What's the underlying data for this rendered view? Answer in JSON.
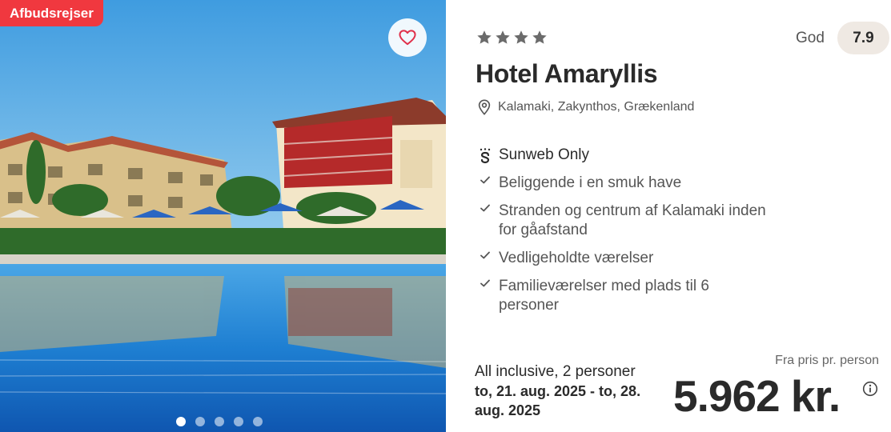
{
  "card": {
    "badge": "Afbudsrejser",
    "favorite_icon": "heart-icon",
    "carousel": {
      "total": 5,
      "active_index": 0
    },
    "stars": 4,
    "rating_label": "God",
    "rating_value": "7.9",
    "hotel_name": "Hotel Amaryllis",
    "location_icon": "map-pin-icon",
    "location": "Kalamaki, Zakynthos, Grækenland",
    "brand_feature": {
      "icon": "sunweb-logo-icon",
      "label": "Sunweb Only"
    },
    "features": [
      {
        "icon": "check-icon",
        "label": "Beliggende i en smuk have"
      },
      {
        "icon": "check-icon",
        "label": "Stranden og centrum af Kalamaki inden for gåafstand"
      },
      {
        "icon": "check-icon",
        "label": "Vedligeholdte værelser"
      },
      {
        "icon": "check-icon",
        "label": "Familieværelser med plads til 6 personer"
      }
    ],
    "board_and_guests": "All inclusive, 2 personer",
    "dates": "to, 21. aug. 2025 - to, 28. aug. 2025",
    "price_label": "Fra pris pr. person",
    "price": "5.962 kr.",
    "info_icon": "info-icon"
  },
  "colors": {
    "badge": "#f0383f",
    "heart": "#e0304a",
    "text_dark": "#2a2a2a",
    "text_muted": "#555555",
    "rating_pill": "#efe9e3"
  }
}
